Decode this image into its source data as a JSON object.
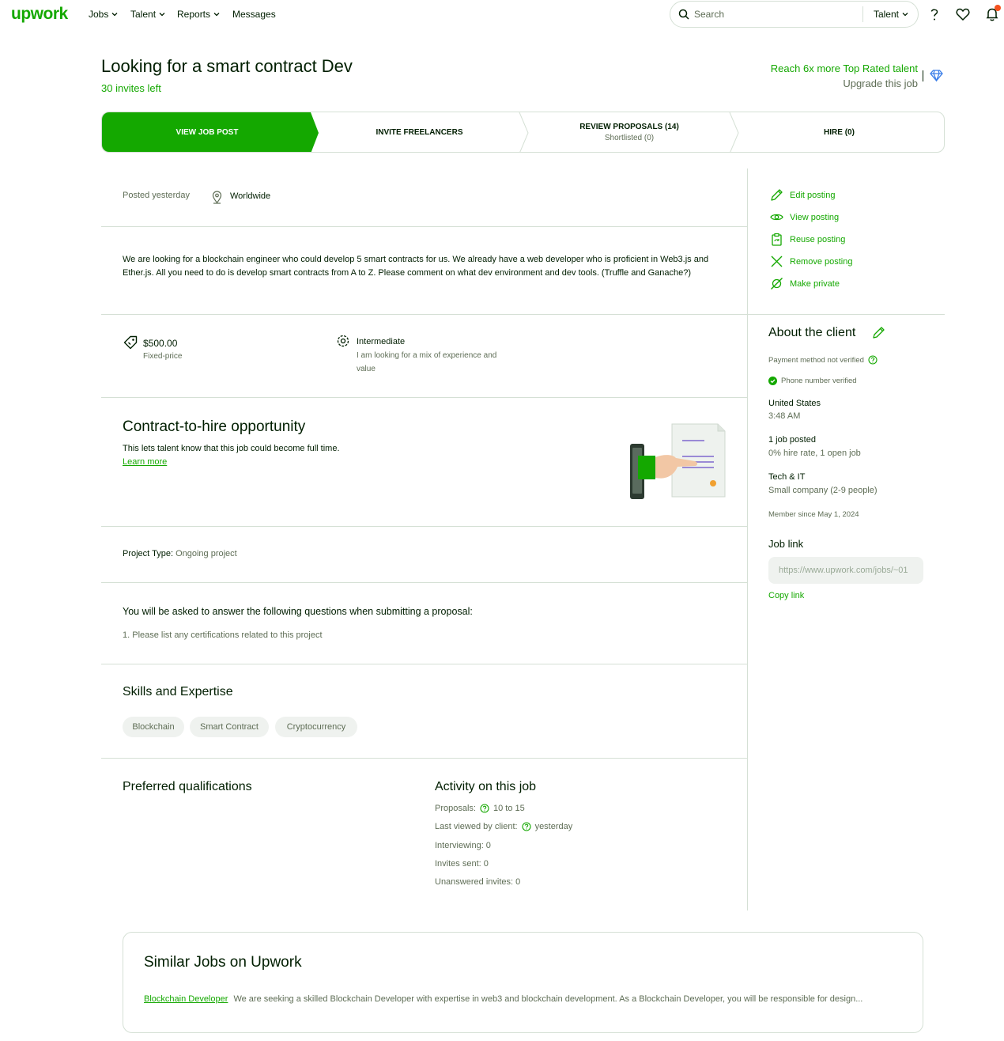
{
  "nav": {
    "logo": "upwork",
    "items": [
      {
        "label": "Jobs",
        "dropdown": true
      },
      {
        "label": "Talent",
        "dropdown": true
      },
      {
        "label": "Reports",
        "dropdown": true
      },
      {
        "label": "Messages",
        "dropdown": false
      }
    ],
    "search_placeholder": "Search",
    "search_type": "Talent",
    "icons": [
      "help-icon",
      "heart-icon",
      "bell-icon"
    ],
    "notification_color": "#f4511e"
  },
  "header": {
    "title": "Looking for a smart contract Dev",
    "invites_left": "30 invites left",
    "upsell_line1": "Reach 6x more Top Rated talent",
    "upsell_line2": "Upgrade this job"
  },
  "steps": [
    {
      "label": "VIEW JOB POST",
      "sub": ""
    },
    {
      "label": "INVITE FREELANCERS",
      "sub": ""
    },
    {
      "label": "REVIEW PROPOSALS (14)",
      "sub": "Shortlisted (0)"
    },
    {
      "label": "HIRE (0)",
      "sub": ""
    }
  ],
  "job": {
    "posted": "Posted yesterday",
    "location": "Worldwide",
    "description": "We are looking for a blockchain engineer who could develop 5 smart contracts for us. We already have a web developer who is proficient in Web3.js and Ether.js. All you need to do is develop smart contracts from A to Z. Please comment on what dev environment and dev tools. (Truffle and Ganache?)",
    "price": "$500.00",
    "price_type": "Fixed-price",
    "level": "Intermediate",
    "level_desc_line1": "I am looking for a mix of experience and",
    "level_desc_line2": "value",
    "cth_title": "Contract-to-hire opportunity",
    "cth_desc": "This lets talent know that this job could become full time.",
    "cth_link": "Learn more",
    "project_type_label": "Project Type:",
    "project_type": "Ongoing project",
    "questions_title": "You will be asked to answer the following questions when submitting a proposal:",
    "question_1": "1. Please list any certifications related to this project",
    "skills_title": "Skills and Expertise",
    "skills": [
      "Blockchain",
      "Smart Contract",
      "Cryptocurrency"
    ],
    "preferred_title": "Preferred qualifications",
    "activity_title": "Activity on this job",
    "activity": {
      "proposals_label": "Proposals:",
      "proposals_value": "10 to 15",
      "last_viewed_label": "Last viewed by client:",
      "last_viewed_value": "yesterday",
      "interviewing": "Interviewing: 0",
      "invites_sent": "Invites sent: 0",
      "unanswered": "Unanswered invites: 0"
    }
  },
  "sidebar": {
    "actions": [
      {
        "label": "Edit posting",
        "icon": "pencil-icon"
      },
      {
        "label": "View posting",
        "icon": "eye-icon"
      },
      {
        "label": "Reuse posting",
        "icon": "reuse-icon"
      },
      {
        "label": "Remove posting",
        "icon": "x-icon"
      },
      {
        "label": "Make private",
        "icon": "eye-off-icon"
      }
    ],
    "about_title": "About the client",
    "payment": "Payment method not verified",
    "phone": "Phone number verified",
    "country": "United States",
    "time": "3:48 AM",
    "jobs_posted": "1 job posted",
    "hire_rate": "0% hire rate, 1 open job",
    "industry": "Tech & IT",
    "company_size": "Small company (2-9 people)",
    "member_since": "Member since May 1, 2024",
    "job_link_title": "Job link",
    "job_link_value": "https://www.upwork.com/jobs/~01",
    "copy_link": "Copy link"
  },
  "similar": {
    "title": "Similar Jobs on Upwork",
    "link": "Blockchain Developer",
    "text": "We are seeking a skilled Blockchain Developer with expertise in web3 and blockchain development. As a Blockchain Developer, you will be responsible for design..."
  },
  "colors": {
    "accent": "#14a800",
    "border": "#d5e0d5",
    "muted": "#5e6d55"
  }
}
